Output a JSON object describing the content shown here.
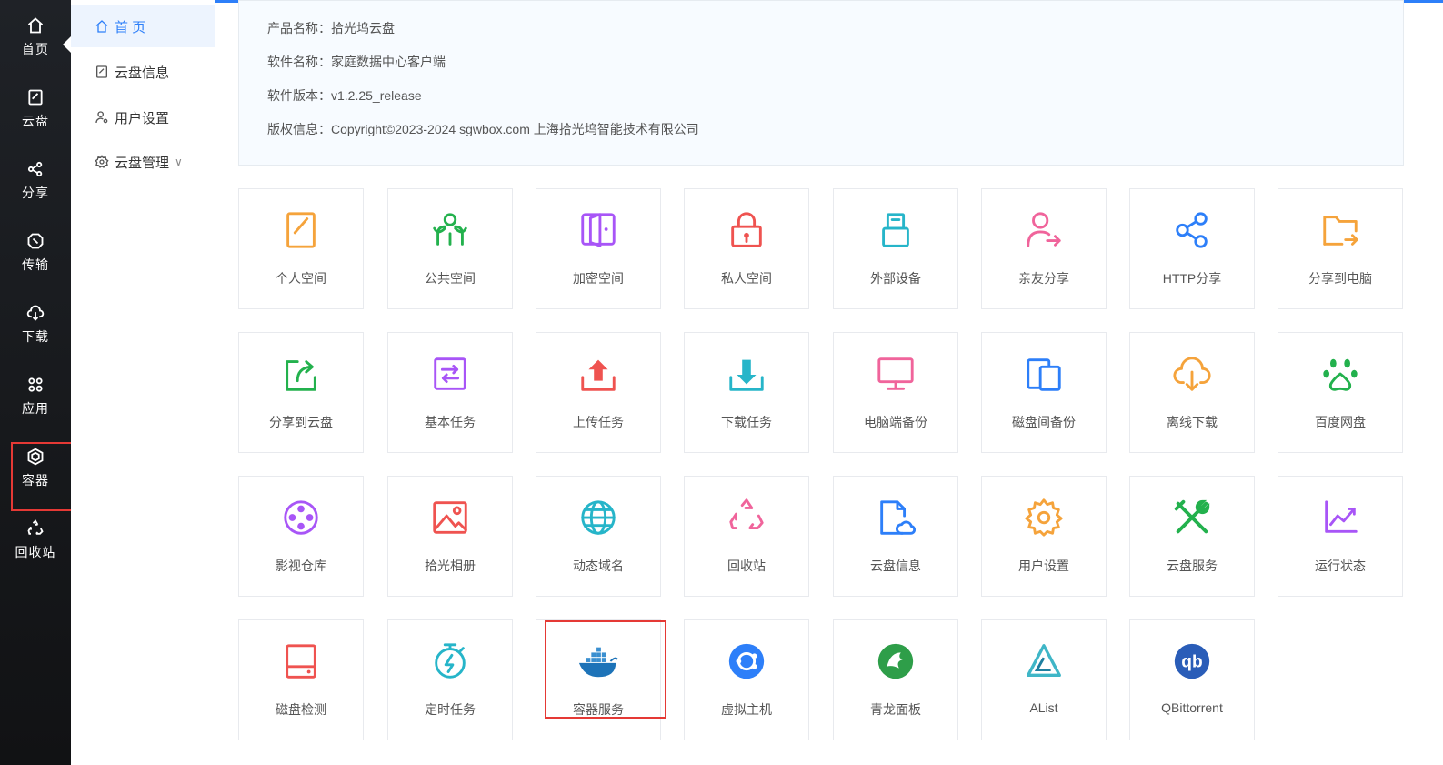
{
  "rail": {
    "items": [
      {
        "label": "首页",
        "icon": "home-icon"
      },
      {
        "label": "云盘",
        "icon": "cloud-disk-icon"
      },
      {
        "label": "分享",
        "icon": "share-icon"
      },
      {
        "label": "传输",
        "icon": "transfer-icon"
      },
      {
        "label": "下载",
        "icon": "download-icon"
      },
      {
        "label": "应用",
        "icon": "apps-icon"
      },
      {
        "label": "容器",
        "icon": "container-icon"
      },
      {
        "label": "回收站",
        "icon": "recycle-icon"
      }
    ]
  },
  "sidebar": {
    "items": [
      {
        "label": "首 页",
        "icon": "home-icon"
      },
      {
        "label": "云盘信息",
        "icon": "disk-info-icon"
      },
      {
        "label": "用户设置",
        "icon": "user-settings-icon"
      },
      {
        "label": "云盘管理",
        "icon": "gear-icon"
      }
    ]
  },
  "info": {
    "product_label": "产品名称：",
    "product_value": "拾光坞云盘",
    "software_label": "软件名称：",
    "software_value": "家庭数据中心客户端",
    "version_label": "软件版本：",
    "version_value": "v1.2.25_release",
    "copyright_label": "版权信息：",
    "copyright_value": "Copyright©2023-2024 sgwbox.com 上海拾光坞智能技术有限公司"
  },
  "tiles": [
    {
      "label": "个人空间",
      "icon": "personal-space-icon",
      "color": "#f5a33b"
    },
    {
      "label": "公共空间",
      "icon": "public-space-icon",
      "color": "#23b14d"
    },
    {
      "label": "加密空间",
      "icon": "encrypted-space-icon",
      "color": "#a855f7"
    },
    {
      "label": "私人空间",
      "icon": "lock-icon",
      "color": "#ef5350"
    },
    {
      "label": "外部设备",
      "icon": "usb-icon",
      "color": "#26b5c9"
    },
    {
      "label": "亲友分享",
      "icon": "friend-share-icon",
      "color": "#f0649b"
    },
    {
      "label": "HTTP分享",
      "icon": "share-icon",
      "color": "#2d7ff9"
    },
    {
      "label": "分享到电脑",
      "icon": "folder-share-icon",
      "color": "#f5a33b"
    },
    {
      "label": "分享到云盘",
      "icon": "share-to-cloud-icon",
      "color": "#23b14d"
    },
    {
      "label": "基本任务",
      "icon": "basic-task-icon",
      "color": "#a855f7"
    },
    {
      "label": "上传任务",
      "icon": "upload-icon",
      "color": "#ef5350"
    },
    {
      "label": "下载任务",
      "icon": "download-icon",
      "color": "#26b5c9"
    },
    {
      "label": "电脑端备份",
      "icon": "monitor-icon",
      "color": "#f0649b"
    },
    {
      "label": "磁盘间备份",
      "icon": "disk-backup-icon",
      "color": "#2d7ff9"
    },
    {
      "label": "离线下载",
      "icon": "cloud-download-icon",
      "color": "#f5a33b"
    },
    {
      "label": "百度网盘",
      "icon": "paw-icon",
      "color": "#23b14d"
    },
    {
      "label": "影视仓库",
      "icon": "film-reel-icon",
      "color": "#a855f7"
    },
    {
      "label": "拾光相册",
      "icon": "image-icon",
      "color": "#ef5350"
    },
    {
      "label": "动态域名",
      "icon": "globe-icon",
      "color": "#26b5c9"
    },
    {
      "label": "回收站",
      "icon": "recycle-icon",
      "color": "#f0649b"
    },
    {
      "label": "云盘信息",
      "icon": "cloud-file-icon",
      "color": "#2d7ff9"
    },
    {
      "label": "用户设置",
      "icon": "gear-icon",
      "color": "#f5a33b"
    },
    {
      "label": "云盘服务",
      "icon": "tools-icon",
      "color": "#23b14d"
    },
    {
      "label": "运行状态",
      "icon": "chart-icon",
      "color": "#a855f7"
    },
    {
      "label": "磁盘检测",
      "icon": "hard-disk-icon",
      "color": "#ef5350"
    },
    {
      "label": "定时任务",
      "icon": "timer-icon",
      "color": "#26b5c9"
    },
    {
      "label": "容器服务",
      "icon": "docker-icon",
      "color": "#1d73b8"
    },
    {
      "label": "虚拟主机",
      "icon": "ubuntu-icon",
      "color": "#2d7ff9"
    },
    {
      "label": "青龙面板",
      "icon": "qinglong-icon",
      "color": "#2e9e49"
    },
    {
      "label": "AList",
      "icon": "alist-icon",
      "color": "#3fb6c7"
    },
    {
      "label": "QBittorrent",
      "icon": "qbittorrent-icon",
      "color": "#2a5db8"
    }
  ]
}
